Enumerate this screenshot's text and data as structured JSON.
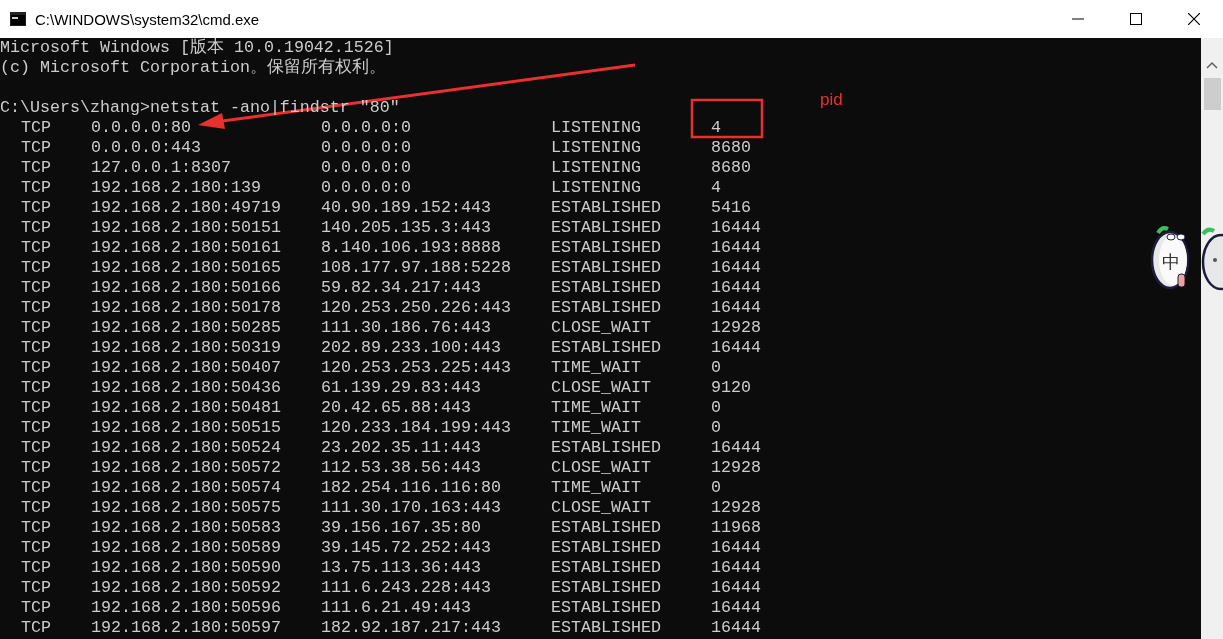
{
  "window": {
    "title": "C:\\WINDOWS\\system32\\cmd.exe"
  },
  "console": {
    "banner": [
      "Microsoft Windows [版本 10.0.19042.1526]",
      "(c) Microsoft Corporation。保留所有权利。"
    ],
    "command": "C:\\Users\\zhang>netstat -ano|findstr \"80\"",
    "rows": [
      {
        "proto": "TCP",
        "local": "0.0.0.0:80",
        "foreign": "0.0.0.0:0",
        "state": "LISTENING",
        "pid": "4"
      },
      {
        "proto": "TCP",
        "local": "0.0.0.0:443",
        "foreign": "0.0.0.0:0",
        "state": "LISTENING",
        "pid": "8680"
      },
      {
        "proto": "TCP",
        "local": "127.0.0.1:8307",
        "foreign": "0.0.0.0:0",
        "state": "LISTENING",
        "pid": "8680"
      },
      {
        "proto": "TCP",
        "local": "192.168.2.180:139",
        "foreign": "0.0.0.0:0",
        "state": "LISTENING",
        "pid": "4"
      },
      {
        "proto": "TCP",
        "local": "192.168.2.180:49719",
        "foreign": "40.90.189.152:443",
        "state": "ESTABLISHED",
        "pid": "5416"
      },
      {
        "proto": "TCP",
        "local": "192.168.2.180:50151",
        "foreign": "140.205.135.3:443",
        "state": "ESTABLISHED",
        "pid": "16444"
      },
      {
        "proto": "TCP",
        "local": "192.168.2.180:50161",
        "foreign": "8.140.106.193:8888",
        "state": "ESTABLISHED",
        "pid": "16444"
      },
      {
        "proto": "TCP",
        "local": "192.168.2.180:50165",
        "foreign": "108.177.97.188:5228",
        "state": "ESTABLISHED",
        "pid": "16444"
      },
      {
        "proto": "TCP",
        "local": "192.168.2.180:50166",
        "foreign": "59.82.34.217:443",
        "state": "ESTABLISHED",
        "pid": "16444"
      },
      {
        "proto": "TCP",
        "local": "192.168.2.180:50178",
        "foreign": "120.253.250.226:443",
        "state": "ESTABLISHED",
        "pid": "16444"
      },
      {
        "proto": "TCP",
        "local": "192.168.2.180:50285",
        "foreign": "111.30.186.76:443",
        "state": "CLOSE_WAIT",
        "pid": "12928"
      },
      {
        "proto": "TCP",
        "local": "192.168.2.180:50319",
        "foreign": "202.89.233.100:443",
        "state": "ESTABLISHED",
        "pid": "16444"
      },
      {
        "proto": "TCP",
        "local": "192.168.2.180:50407",
        "foreign": "120.253.253.225:443",
        "state": "TIME_WAIT",
        "pid": "0"
      },
      {
        "proto": "TCP",
        "local": "192.168.2.180:50436",
        "foreign": "61.139.29.83:443",
        "state": "CLOSE_WAIT",
        "pid": "9120"
      },
      {
        "proto": "TCP",
        "local": "192.168.2.180:50481",
        "foreign": "20.42.65.88:443",
        "state": "TIME_WAIT",
        "pid": "0"
      },
      {
        "proto": "TCP",
        "local": "192.168.2.180:50515",
        "foreign": "120.233.184.199:443",
        "state": "TIME_WAIT",
        "pid": "0"
      },
      {
        "proto": "TCP",
        "local": "192.168.2.180:50524",
        "foreign": "23.202.35.11:443",
        "state": "ESTABLISHED",
        "pid": "16444"
      },
      {
        "proto": "TCP",
        "local": "192.168.2.180:50572",
        "foreign": "112.53.38.56:443",
        "state": "CLOSE_WAIT",
        "pid": "12928"
      },
      {
        "proto": "TCP",
        "local": "192.168.2.180:50574",
        "foreign": "182.254.116.116:80",
        "state": "TIME_WAIT",
        "pid": "0"
      },
      {
        "proto": "TCP",
        "local": "192.168.2.180:50575",
        "foreign": "111.30.170.163:443",
        "state": "CLOSE_WAIT",
        "pid": "12928"
      },
      {
        "proto": "TCP",
        "local": "192.168.2.180:50583",
        "foreign": "39.156.167.35:80",
        "state": "ESTABLISHED",
        "pid": "11968"
      },
      {
        "proto": "TCP",
        "local": "192.168.2.180:50589",
        "foreign": "39.145.72.252:443",
        "state": "ESTABLISHED",
        "pid": "16444"
      },
      {
        "proto": "TCP",
        "local": "192.168.2.180:50590",
        "foreign": "13.75.113.36:443",
        "state": "ESTABLISHED",
        "pid": "16444"
      },
      {
        "proto": "TCP",
        "local": "192.168.2.180:50592",
        "foreign": "111.6.243.228:443",
        "state": "ESTABLISHED",
        "pid": "16444"
      },
      {
        "proto": "TCP",
        "local": "192.168.2.180:50596",
        "foreign": "111.6.21.49:443",
        "state": "ESTABLISHED",
        "pid": "16444"
      },
      {
        "proto": "TCP",
        "local": "192.168.2.180:50597",
        "foreign": "182.92.187.217:443",
        "state": "ESTABLISHED",
        "pid": "16444"
      }
    ]
  },
  "annotation": {
    "label": "pid"
  },
  "ime_widget": {
    "mode": "中"
  }
}
